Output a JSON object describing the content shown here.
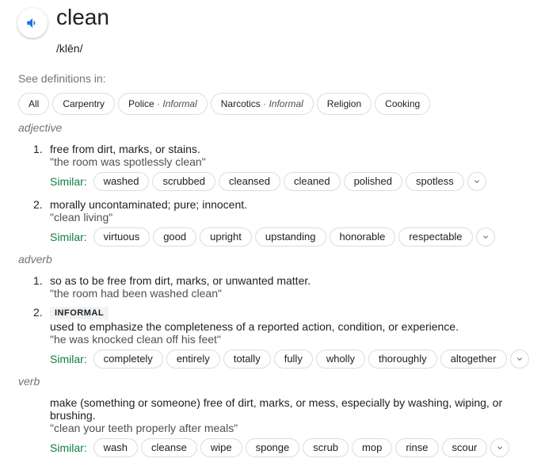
{
  "headword": "clean",
  "phonetic": "/klēn/",
  "see_definitions_label": "See definitions in:",
  "filter_chips": [
    {
      "label": "All"
    },
    {
      "label": "Carpentry"
    },
    {
      "label": "Police",
      "sep": " · ",
      "note": "Informal"
    },
    {
      "label": "Narcotics",
      "sep": " · ",
      "note": "Informal"
    },
    {
      "label": "Religion"
    },
    {
      "label": "Cooking"
    }
  ],
  "similar_label": "Similar:",
  "sections": [
    {
      "pos": "adjective",
      "senses": [
        {
          "number": "1.",
          "definition": "free from dirt, marks, or stains.",
          "example": "\"the room was spotlessly clean\"",
          "similar": [
            "washed",
            "scrubbed",
            "cleansed",
            "cleaned",
            "polished",
            "spotless"
          ]
        },
        {
          "number": "2.",
          "definition": "morally uncontaminated; pure; innocent.",
          "example": "\"clean living\"",
          "similar": [
            "virtuous",
            "good",
            "upright",
            "upstanding",
            "honorable",
            "respectable"
          ]
        }
      ]
    },
    {
      "pos": "adverb",
      "senses": [
        {
          "number": "1.",
          "definition": "so as to be free from dirt, marks, or unwanted matter.",
          "example": "\"the room had been washed clean\""
        },
        {
          "number": "2.",
          "tag": "INFORMAL",
          "definition": "used to emphasize the completeness of a reported action, condition, or experience.",
          "example": "\"he was knocked clean off his feet\"",
          "similar": [
            "completely",
            "entirely",
            "totally",
            "fully",
            "wholly",
            "thoroughly",
            "altogether"
          ]
        }
      ]
    },
    {
      "pos": "verb",
      "senses": [
        {
          "definition_line1": "make (something or someone) free of dirt, marks, or mess, especially by washing, wiping, or",
          "definition_line2": "brushing.",
          "example": "\"clean your teeth properly after meals\"",
          "similar": [
            "wash",
            "cleanse",
            "wipe",
            "sponge",
            "scrub",
            "mop",
            "rinse",
            "scour"
          ]
        }
      ]
    }
  ],
  "colors": {
    "accent_blue": "#1a73e8",
    "similar_green": "#0f7e42",
    "muted": "#70757a",
    "chip_border": "#dadce0"
  },
  "icons": {
    "pronounce": "speaker-icon",
    "expand": "chevron-down-icon"
  }
}
